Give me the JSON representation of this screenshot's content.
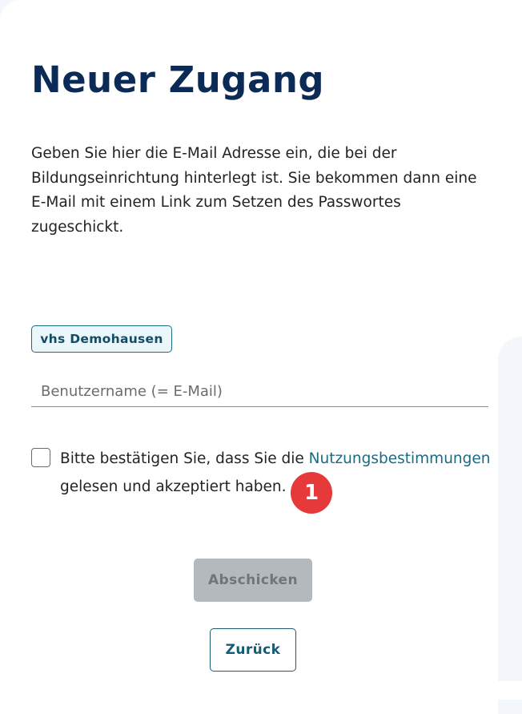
{
  "page": {
    "title": "Neuer Zugang",
    "intro": "Geben Sie hier die E-Mail Adresse ein, die bei der Bildungseinrichtung hinterlegt ist. Sie bekommen dann eine E-Mail mit einem Link zum Setzen des Passwortes zugeschickt."
  },
  "tenant": {
    "label": "vhs Demohausen"
  },
  "username": {
    "placeholder": "Benutzername (= E-Mail)",
    "value": ""
  },
  "consent": {
    "checked": false,
    "text_before": "Bitte bestätigen Sie, dass Sie die ",
    "link_text": "Nutzungsbestimmungen",
    "text_after": " gelesen und akzeptiert haben."
  },
  "annotation": {
    "step_number": "1",
    "color": "#e63a3a"
  },
  "actions": {
    "submit_label": "Abschicken",
    "submit_disabled": true,
    "back_label": "Zurück"
  },
  "colors": {
    "title": "#0b2a55",
    "link": "#1a6a86",
    "badge_border": "#1b6e86",
    "badge_background": "#eaf6f9",
    "button_disabled_bg": "#b4b9bd",
    "button_outline": "#1d5a74"
  }
}
